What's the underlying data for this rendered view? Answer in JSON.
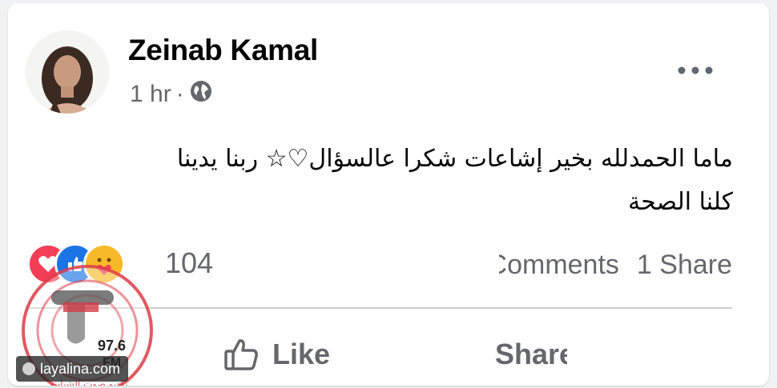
{
  "post": {
    "author": "Zeinab Kamal",
    "time": "1 hr",
    "separator": "·",
    "privacy_icon": "globe-icon",
    "more_icon": "ellipsis-icon",
    "text_line1": "ماما الحمدلله بخير إشاعات شكرا عالسؤال♡☆ ربنا يدينا",
    "text_line2": "كلنا الصحة"
  },
  "reactions": {
    "icons": [
      "love-reaction-icon",
      "like-reaction-icon",
      "care-reaction-icon"
    ],
    "count": "104"
  },
  "stats": {
    "comments": "Comments",
    "shares": "1 Share"
  },
  "actions": {
    "like": "Like",
    "share": "Share"
  },
  "watermark": {
    "site": "layalina.com",
    "station": "97.6",
    "band": "FM",
    "station_name": "راديو صوت الشباب"
  },
  "colors": {
    "text_primary": "#050505",
    "text_secondary": "#65676b",
    "love": "#f33e58",
    "like": "#1b74e4",
    "care": "#f7b928"
  }
}
